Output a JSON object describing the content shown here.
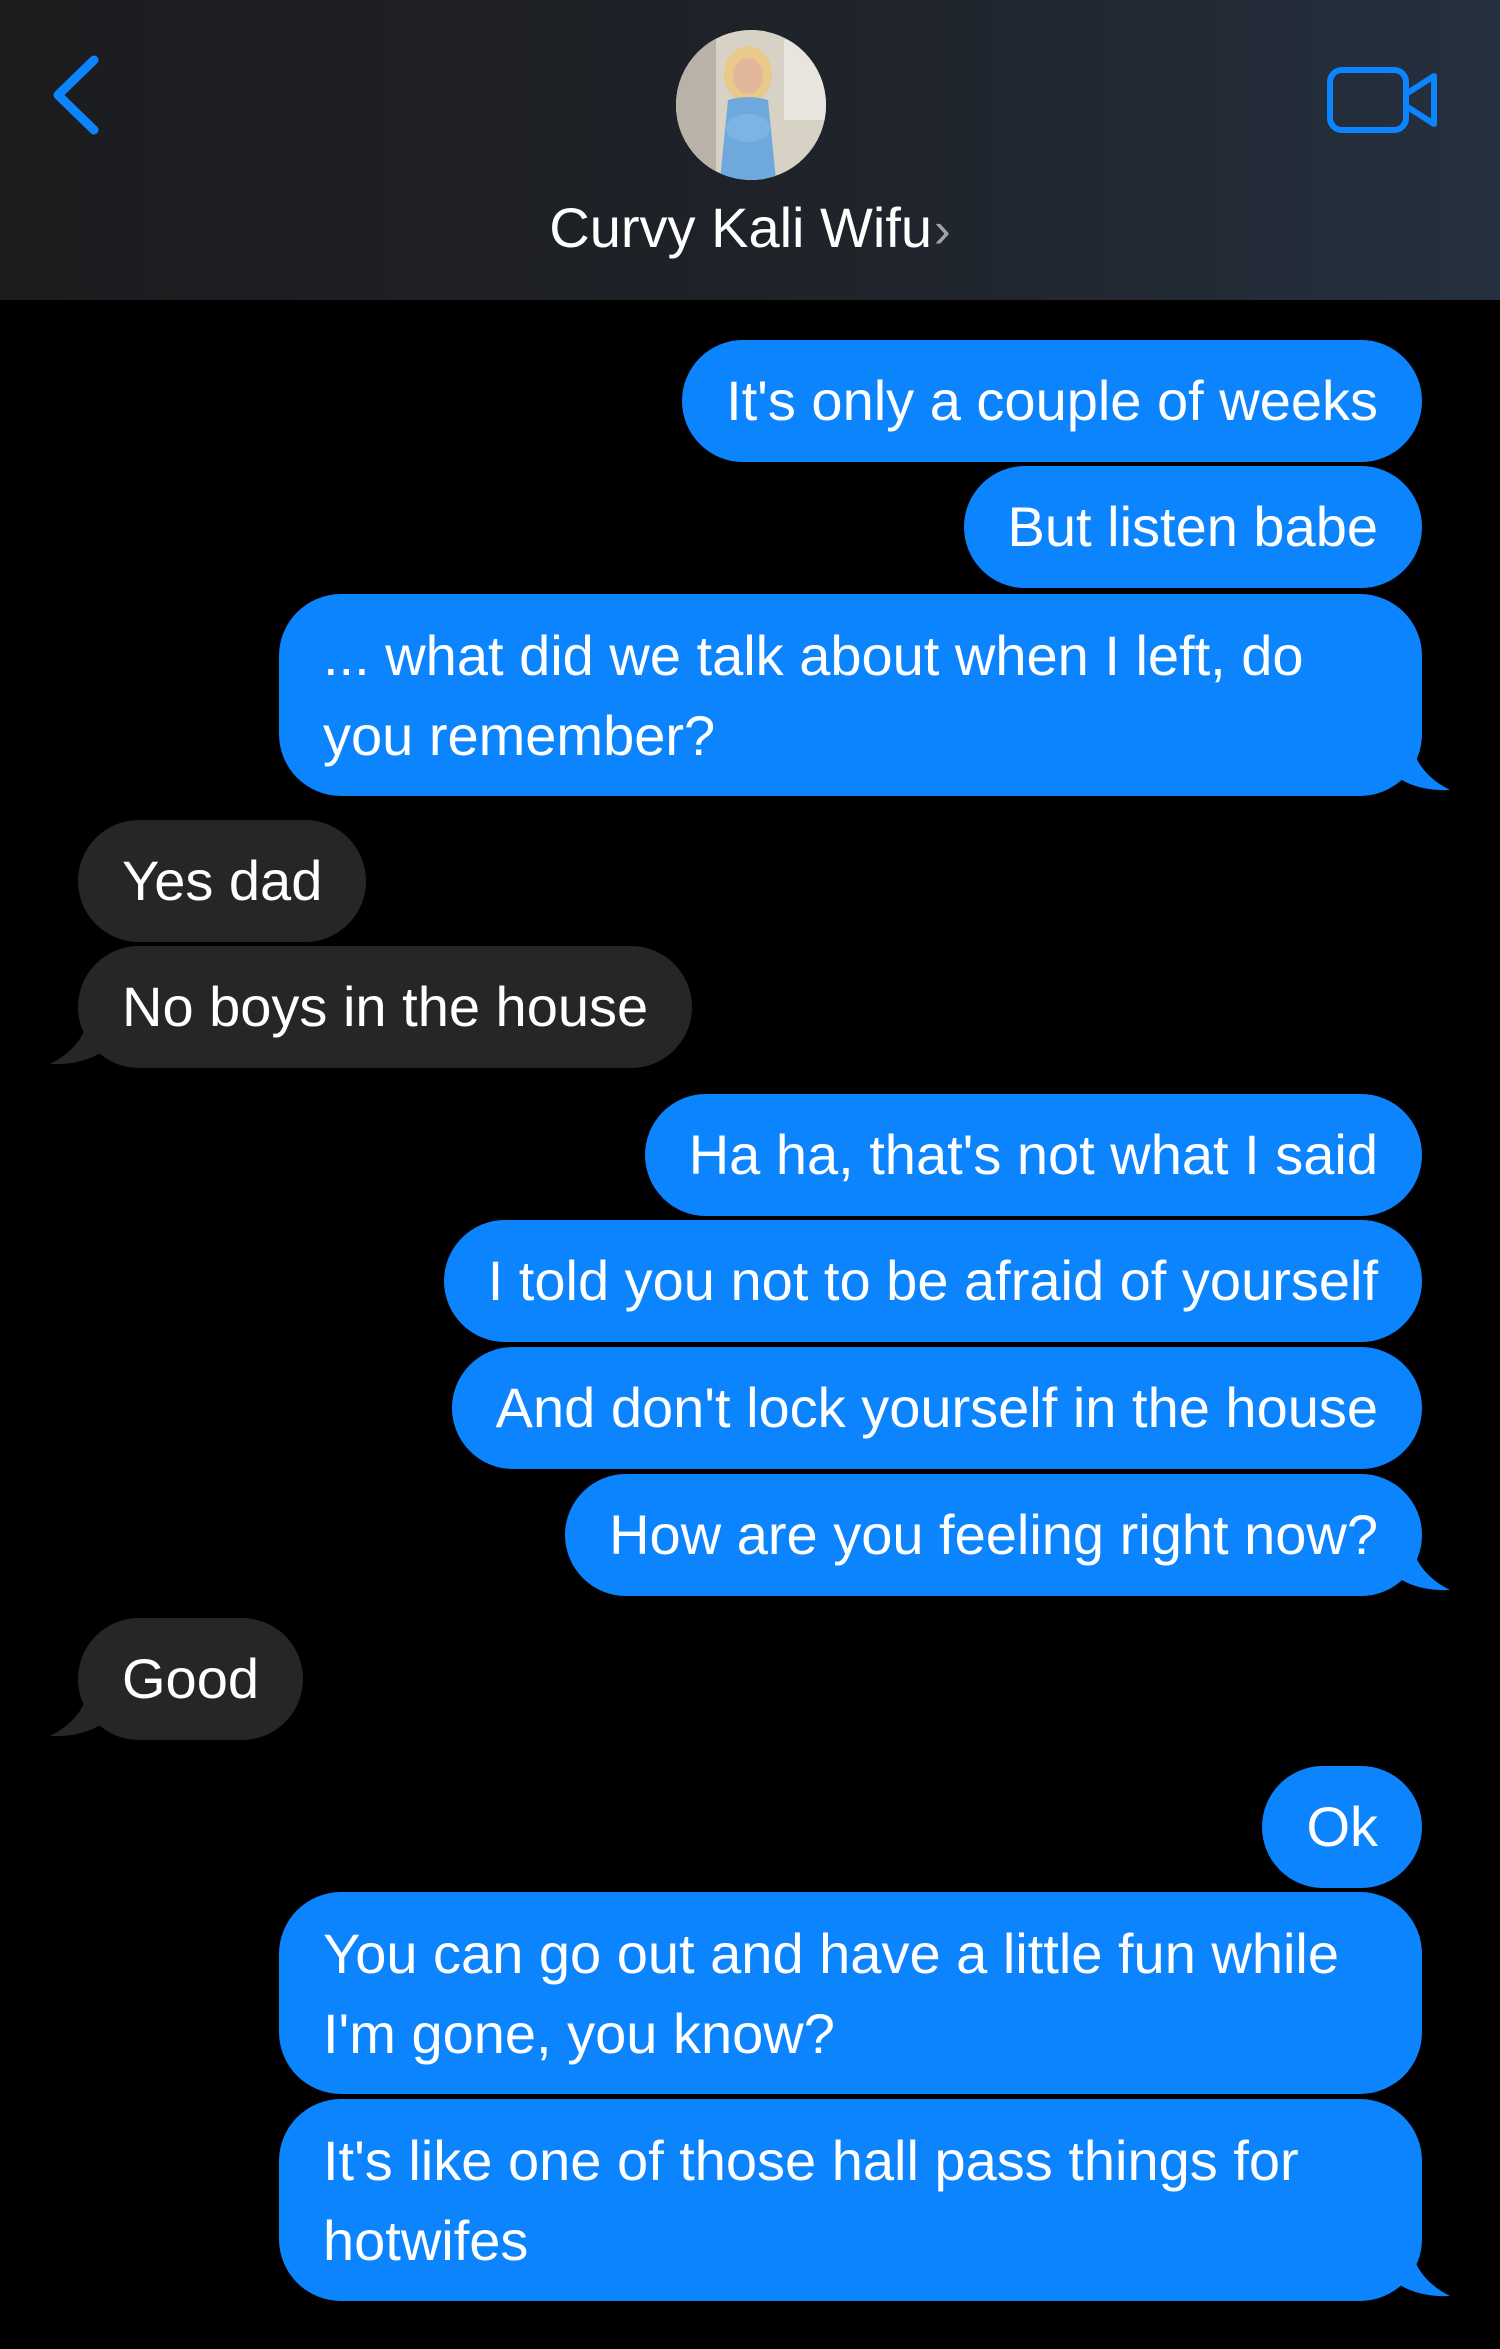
{
  "header": {
    "contact_name": "Curvy Kali Wifu",
    "contact_chevron": "›",
    "back_icon": "chevron-left-icon",
    "video_icon": "video-camera-icon",
    "accent_color": "#0b84fe"
  },
  "messages": [
    {
      "from": "me",
      "text": "It's only a couple of weeks"
    },
    {
      "from": "me",
      "text": "But listen babe"
    },
    {
      "from": "me",
      "text": "... what did we talk about when I left, do you remember?"
    },
    {
      "from": "them",
      "text": "Yes dad"
    },
    {
      "from": "them",
      "text": "No boys in the house"
    },
    {
      "from": "me",
      "text": "Ha ha, that's not what I said"
    },
    {
      "from": "me",
      "text": "I told you not to be afraid of yourself"
    },
    {
      "from": "me",
      "text": "And don't lock yourself in the house"
    },
    {
      "from": "me",
      "text": "How are you feeling right now?"
    },
    {
      "from": "them",
      "text": "Good"
    },
    {
      "from": "me",
      "text": "Ok"
    },
    {
      "from": "me",
      "text": "You can go out and have a little fun while I'm gone, you know?"
    },
    {
      "from": "me",
      "text": "It's like one of those hall pass things for hotwifes"
    }
  ],
  "colors": {
    "sent_bubble": "#0b84fe",
    "received_bubble": "#262628",
    "background": "#000000"
  }
}
